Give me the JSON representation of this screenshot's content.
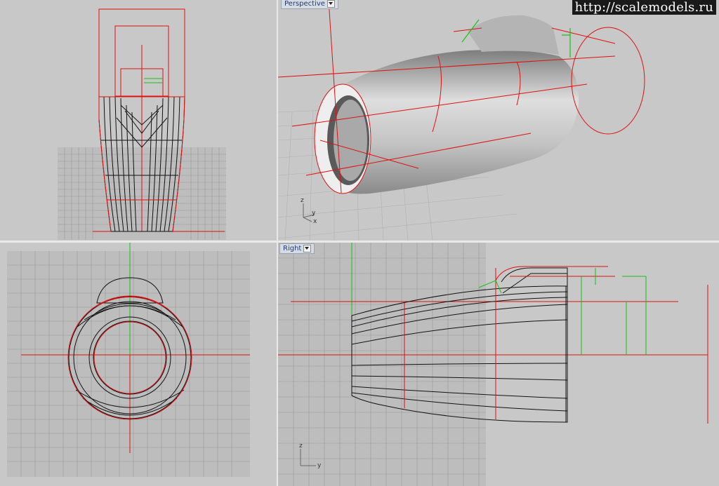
{
  "watermark": {
    "text": "http://scalemodels.ru"
  },
  "viewports": {
    "perspective": {
      "label": "Perspective"
    },
    "right": {
      "label": "Right"
    }
  },
  "axes": {
    "x": "x",
    "y": "y",
    "z": "z"
  },
  "colors": {
    "background": "#c8c8c8",
    "grid": "#9a9a9a",
    "red": "#e01010",
    "green": "#18c018",
    "black": "#111111"
  }
}
